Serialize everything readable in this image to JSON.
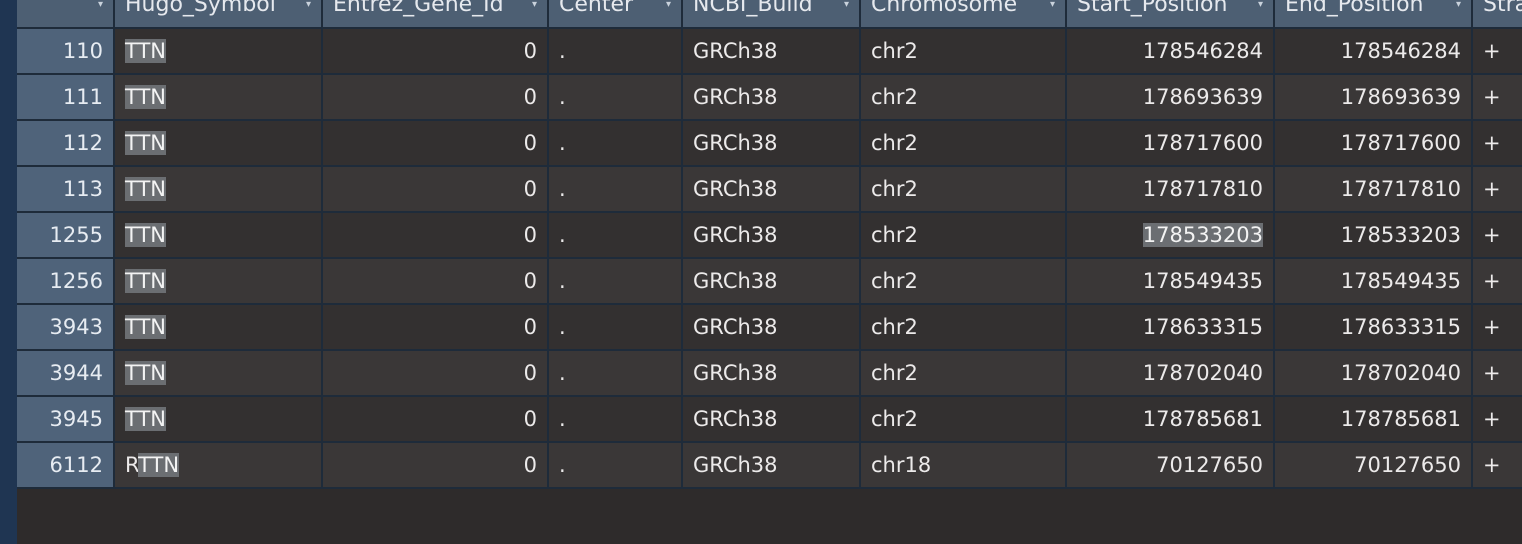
{
  "columns": [
    "",
    "Hugo_Symbol",
    "Entrez_Gene_Id",
    "Center",
    "NCBI_Build",
    "Chromosome",
    "Start_Position",
    "End_Position",
    "Strand"
  ],
  "rows": [
    {
      "rownum": "110",
      "hugo_prefix": "",
      "hugo": "TTN",
      "entrez": "0",
      "center": ".",
      "build": "GRCh38",
      "chrom": "chr2",
      "start": "178546284",
      "end": "178546284",
      "strand": "+"
    },
    {
      "rownum": "111",
      "hugo_prefix": "",
      "hugo": "TTN",
      "entrez": "0",
      "center": ".",
      "build": "GRCh38",
      "chrom": "chr2",
      "start": "178693639",
      "end": "178693639",
      "strand": "+"
    },
    {
      "rownum": "112",
      "hugo_prefix": "",
      "hugo": "TTN",
      "entrez": "0",
      "center": ".",
      "build": "GRCh38",
      "chrom": "chr2",
      "start": "178717600",
      "end": "178717600",
      "strand": "+"
    },
    {
      "rownum": "113",
      "hugo_prefix": "",
      "hugo": "TTN",
      "entrez": "0",
      "center": ".",
      "build": "GRCh38",
      "chrom": "chr2",
      "start": "178717810",
      "end": "178717810",
      "strand": "+"
    },
    {
      "rownum": "1255",
      "hugo_prefix": "",
      "hugo": "TTN",
      "entrez": "0",
      "center": ".",
      "build": "GRCh38",
      "chrom": "chr2",
      "start": "178533203",
      "end": "178533203",
      "strand": "+"
    },
    {
      "rownum": "1256",
      "hugo_prefix": "",
      "hugo": "TTN",
      "entrez": "0",
      "center": ".",
      "build": "GRCh38",
      "chrom": "chr2",
      "start": "178549435",
      "end": "178549435",
      "strand": "+"
    },
    {
      "rownum": "3943",
      "hugo_prefix": "",
      "hugo": "TTN",
      "entrez": "0",
      "center": ".",
      "build": "GRCh38",
      "chrom": "chr2",
      "start": "178633315",
      "end": "178633315",
      "strand": "+"
    },
    {
      "rownum": "3944",
      "hugo_prefix": "",
      "hugo": "TTN",
      "entrez": "0",
      "center": ".",
      "build": "GRCh38",
      "chrom": "chr2",
      "start": "178702040",
      "end": "178702040",
      "strand": "+"
    },
    {
      "rownum": "3945",
      "hugo_prefix": "",
      "hugo": "TTN",
      "entrez": "0",
      "center": ".",
      "build": "GRCh38",
      "chrom": "chr2",
      "start": "178785681",
      "end": "178785681",
      "strand": "+"
    },
    {
      "rownum": "6112",
      "hugo_prefix": "R",
      "hugo": "TTN",
      "entrez": "0",
      "center": ".",
      "build": "GRCh38",
      "chrom": "chr18",
      "start": "70127650",
      "end": "70127650",
      "strand": "+"
    }
  ],
  "search_highlight": "TTN",
  "selected_cell": {
    "row": 4,
    "column": "Start_Position"
  },
  "colors": {
    "header_bg": "#4d5f73",
    "rownum_bg": "#4f637a",
    "row_bg_odd": "#333030",
    "row_bg_even": "#3a3737",
    "grid_line": "#1e2b3a",
    "highlight_bg": "#6b6e72"
  },
  "icons": {
    "sort": "chevron-down-icon"
  }
}
